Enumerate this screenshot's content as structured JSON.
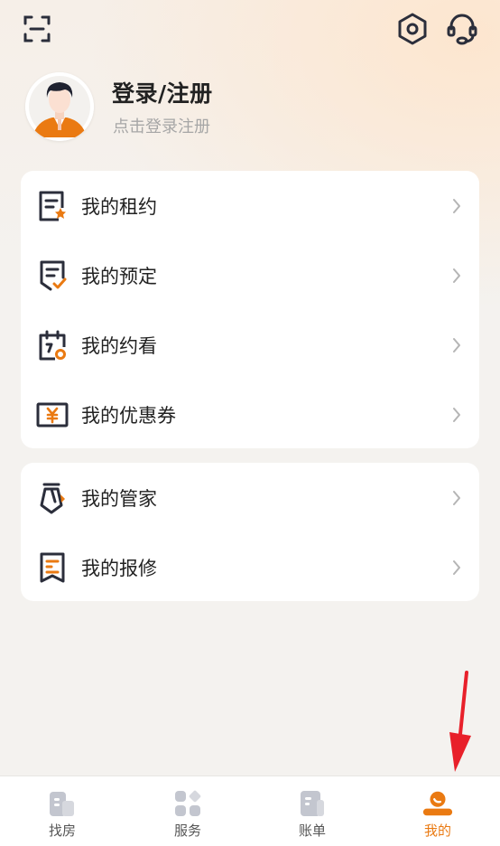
{
  "profile": {
    "title": "登录/注册",
    "subtitle": "点击登录注册"
  },
  "topbar": {
    "icons": [
      "scan-icon",
      "settings-icon",
      "customer-service-icon"
    ]
  },
  "menu_group_1": [
    {
      "label": "我的租约",
      "icon": "lease-icon"
    },
    {
      "label": "我的预定",
      "icon": "reservation-icon"
    },
    {
      "label": "我的约看",
      "icon": "viewing-appointment-icon"
    },
    {
      "label": "我的优惠券",
      "icon": "coupon-icon"
    }
  ],
  "menu_group_2": [
    {
      "label": "我的管家",
      "icon": "butler-icon"
    },
    {
      "label": "我的报修",
      "icon": "repair-icon"
    }
  ],
  "tabs": [
    {
      "label": "找房",
      "icon": "find-house-icon"
    },
    {
      "label": "服务",
      "icon": "services-icon"
    },
    {
      "label": "账单",
      "icon": "bill-icon"
    },
    {
      "label": "我的",
      "icon": "mine-icon"
    }
  ],
  "colors": {
    "accent": "#ea7a12",
    "annotation_arrow": "#e8202a",
    "icon_dark": "#2b2e3b",
    "inactive_tab_icon": "#c3c6cf"
  }
}
